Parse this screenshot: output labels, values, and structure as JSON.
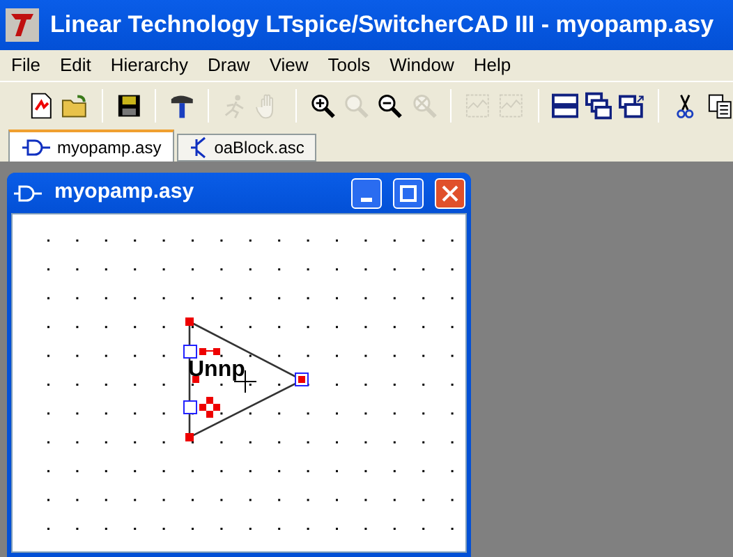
{
  "window": {
    "title": "Linear Technology LTspice/SwitcherCAD III - myopamp.asy"
  },
  "menu": [
    "File",
    "Edit",
    "Hierarchy",
    "Draw",
    "View",
    "Tools",
    "Window",
    "Help"
  ],
  "toolbar": [
    {
      "kind": "new-schematic",
      "disabled": false
    },
    {
      "kind": "open",
      "disabled": false
    },
    {
      "kind": "separator"
    },
    {
      "kind": "save",
      "disabled": false
    },
    {
      "kind": "separator"
    },
    {
      "kind": "hammer",
      "disabled": false
    },
    {
      "kind": "separator"
    },
    {
      "kind": "run",
      "disabled": true
    },
    {
      "kind": "pan",
      "disabled": true
    },
    {
      "kind": "separator"
    },
    {
      "kind": "zoom-in",
      "disabled": false
    },
    {
      "kind": "zoom-fit",
      "disabled": true
    },
    {
      "kind": "zoom-out",
      "disabled": false
    },
    {
      "kind": "zoom-cancel",
      "disabled": true
    },
    {
      "kind": "separator"
    },
    {
      "kind": "plot",
      "disabled": true
    },
    {
      "kind": "plot-edit",
      "disabled": true
    },
    {
      "kind": "separator"
    },
    {
      "kind": "tile",
      "disabled": false
    },
    {
      "kind": "cascade",
      "disabled": false
    },
    {
      "kind": "arrange",
      "disabled": false
    },
    {
      "kind": "separator"
    },
    {
      "kind": "cut",
      "disabled": false
    },
    {
      "kind": "copy",
      "disabled": false
    }
  ],
  "tabs": [
    {
      "label": "myopamp.asy",
      "selected": true,
      "kind": "symbol"
    },
    {
      "label": "oaBlock.asc",
      "selected": false,
      "kind": "schematic"
    }
  ],
  "document": {
    "title": "myopamp.asy",
    "symbol_text": "Unnp"
  }
}
